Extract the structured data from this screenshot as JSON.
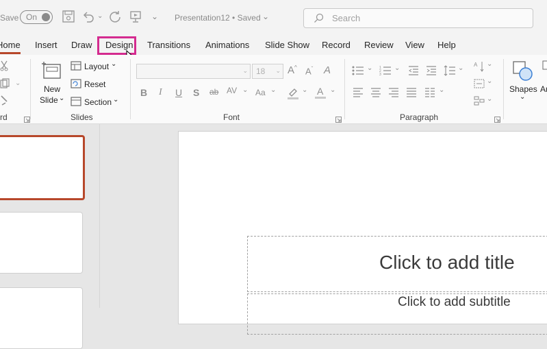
{
  "titlebar": {
    "autosave_label": "Save",
    "toggle_state": "On",
    "doc_title": "Presentation12 • Saved",
    "search_placeholder": "Search"
  },
  "tabs": [
    "Home",
    "Insert",
    "Draw",
    "Design",
    "Transitions",
    "Animations",
    "Slide Show",
    "Record",
    "Review",
    "View",
    "Help"
  ],
  "active_tab": "Home",
  "highlighted_tab": "Design",
  "ribbon": {
    "clipboard_label": "rd",
    "slides": {
      "new_slide_line1": "New",
      "new_slide_line2": "Slide",
      "layout": "Layout",
      "reset": "Reset",
      "section": "Section",
      "group_label": "Slides"
    },
    "font": {
      "font_size": "18",
      "group_label": "Font"
    },
    "paragraph": {
      "group_label": "Paragraph"
    },
    "drawing": {
      "shapes": "Shapes",
      "arrange_partial": "Ar"
    }
  },
  "slide": {
    "title_placeholder": "Click to add title",
    "subtitle_placeholder": "Click to add subtitle"
  },
  "colors": {
    "accent": "#b7472a",
    "highlight_box": "#d42b8f"
  }
}
